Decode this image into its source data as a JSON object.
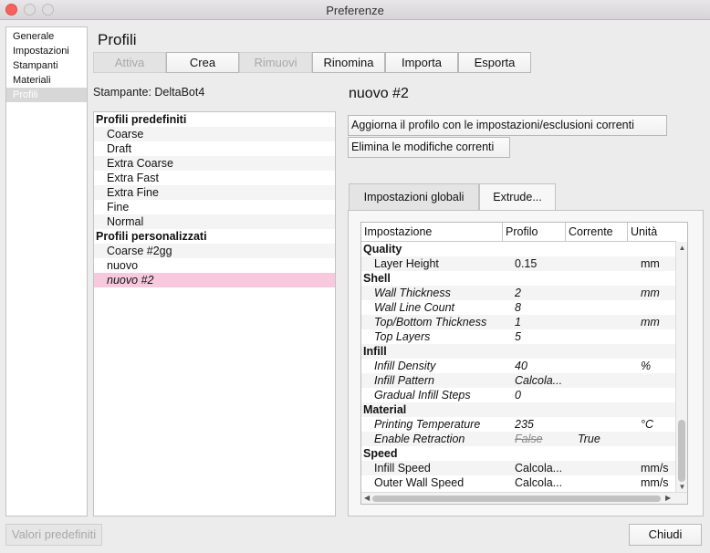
{
  "window": {
    "title": "Preferenze"
  },
  "sidebar": {
    "items": [
      {
        "label": "Generale"
      },
      {
        "label": "Impostazioni"
      },
      {
        "label": "Stampanti"
      },
      {
        "label": "Materiali"
      },
      {
        "label": "Profili",
        "selected": true
      }
    ]
  },
  "page": {
    "title": "Profili"
  },
  "toolbar": {
    "activate": "Attiva",
    "create": "Crea",
    "remove": "Rimuovi",
    "rename": "Rinomina",
    "import": "Importa",
    "export": "Esporta"
  },
  "printer": {
    "label": "Stampante: DeltaBot4"
  },
  "profiles": {
    "predefined_header": "Profili predefiniti",
    "predefined": [
      "Coarse",
      "Draft",
      "Extra Coarse",
      "Extra Fast",
      "Extra Fine",
      "Fine",
      "Normal"
    ],
    "custom_header": "Profili personalizzati",
    "custom": [
      "Coarse #2gg",
      "nuovo",
      "nuovo #2"
    ]
  },
  "detail": {
    "title": "nuovo #2",
    "update_button": "Aggiorna il profilo con le impostazioni/esclusioni correnti",
    "discard_button": "Elimina le modifiche correnti"
  },
  "tabs": [
    {
      "label": "Impostazioni globali"
    },
    {
      "label": "Extrude...",
      "active": true
    }
  ],
  "table": {
    "columns": [
      "Impostazione",
      "Profilo",
      "Corrente",
      "Unità"
    ],
    "rows": [
      {
        "setting": "Quality",
        "category": true
      },
      {
        "setting": "Layer Height",
        "profile": "0.15",
        "current": "",
        "unit": "mm"
      },
      {
        "setting": "Shell",
        "category": true
      },
      {
        "setting": "Wall Thickness",
        "profile": "2",
        "current": "",
        "unit": "mm",
        "user": true
      },
      {
        "setting": "Wall Line Count",
        "profile": "8",
        "current": "",
        "unit": "",
        "user": true
      },
      {
        "setting": "Top/Bottom Thickness",
        "profile": "1",
        "current": "",
        "unit": "mm",
        "user": true
      },
      {
        "setting": "Top Layers",
        "profile": "5",
        "current": "",
        "unit": "",
        "user": true
      },
      {
        "setting": "Infill",
        "category": true
      },
      {
        "setting": "Infill Density",
        "profile": "40",
        "current": "",
        "unit": "%",
        "user": true
      },
      {
        "setting": "Infill Pattern",
        "profile": "Calcola...",
        "current": "",
        "unit": "",
        "user": true
      },
      {
        "setting": "Gradual Infill Steps",
        "profile": "0",
        "current": "",
        "unit": "",
        "user": true
      },
      {
        "setting": "Material",
        "category": true
      },
      {
        "setting": "Printing Temperature",
        "profile": "235",
        "current": "",
        "unit": "°C",
        "user": true
      },
      {
        "setting": "Enable Retraction",
        "profile": "False",
        "current": "True",
        "unit": "",
        "user": true,
        "overridden": true
      },
      {
        "setting": "Speed",
        "category": true
      },
      {
        "setting": "Infill Speed",
        "profile": "Calcola...",
        "current": "",
        "unit": "mm/s"
      },
      {
        "setting": "Outer Wall Speed",
        "profile": "Calcola...",
        "current": "",
        "unit": "mm/s"
      }
    ]
  },
  "footer": {
    "defaults_button": "Valori predefiniti",
    "close_button": "Chiudi"
  }
}
